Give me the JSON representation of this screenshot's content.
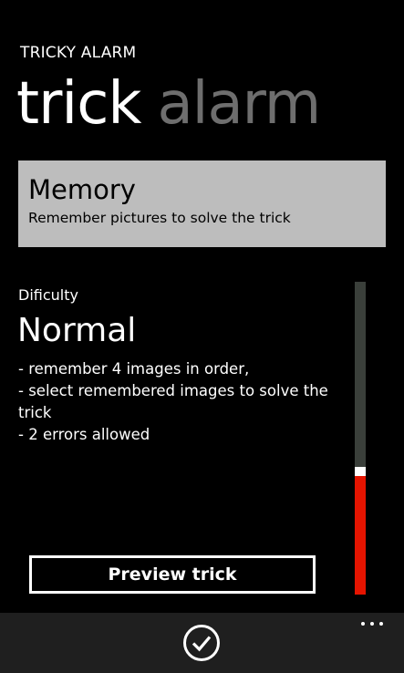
{
  "app": {
    "title": "TRICKY ALARM"
  },
  "pivot": {
    "tabs": [
      {
        "label": "trick",
        "active": true
      },
      {
        "label": "alarm",
        "active": false
      }
    ]
  },
  "trick_card": {
    "title": "Memory",
    "description": "Remember pictures to solve the trick"
  },
  "difficulty": {
    "label": "Dificulty",
    "value": "Normal",
    "details": [
      "- remember 4 images in order,",
      "- select remembered images to solve the trick",
      "- 2 errors allowed"
    ],
    "slider_level_fraction": 0.38
  },
  "preview_button": {
    "label": "Preview trick"
  },
  "app_bar": {
    "ok_icon": "check-circle-icon",
    "more_icon": "ellipsis-icon"
  },
  "colors": {
    "background": "#000000",
    "card": "#bdbdbd",
    "accent": "#e51400",
    "inactive_tab": "#6e6e6e",
    "app_bar": "#1f1f1f"
  }
}
